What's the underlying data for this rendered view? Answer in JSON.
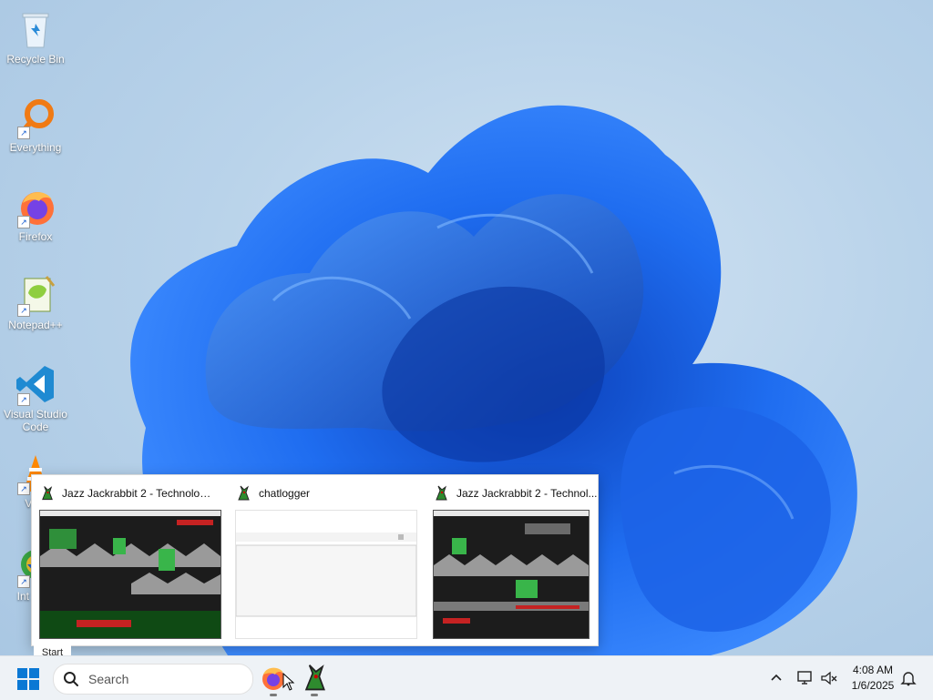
{
  "desktop": {
    "icons": [
      {
        "label": "Recycle Bin",
        "icon": "recycle-bin-icon"
      },
      {
        "label": "Everything",
        "icon": "search-magnifier-icon"
      },
      {
        "label": "Firefox",
        "icon": "firefox-icon"
      },
      {
        "label": "Notepad++",
        "icon": "notepadplusplus-icon"
      },
      {
        "label": "Visual Studio Code",
        "icon": "vscode-icon"
      },
      {
        "label": "VLC",
        "icon": "vlc-cone-icon"
      },
      {
        "label": "Int Dow",
        "icon": "download-manager-icon"
      }
    ]
  },
  "preview": {
    "windows": [
      {
        "title": "Jazz Jackrabbit 2 - Technologic...",
        "icon": "jazz-rabbit-icon"
      },
      {
        "title": "chatlogger",
        "icon": "jazz-rabbit-icon"
      },
      {
        "title": "Jazz Jackrabbit 2 - Technol...",
        "icon": "jazz-rabbit-icon"
      }
    ]
  },
  "start_tooltip": "Start",
  "taskbar": {
    "search_placeholder": "Search",
    "apps": [
      "firefox-icon",
      "jazz-rabbit-icon"
    ],
    "tray_icons": [
      "chevron-up-icon",
      "network-icon",
      "volume-muted-icon",
      "notification-bell-icon"
    ]
  },
  "clock": {
    "time": "4:08 AM",
    "date": "1/6/2025"
  },
  "colors": {
    "accent": "#0067c0",
    "bloom": "#1a5fe0"
  }
}
